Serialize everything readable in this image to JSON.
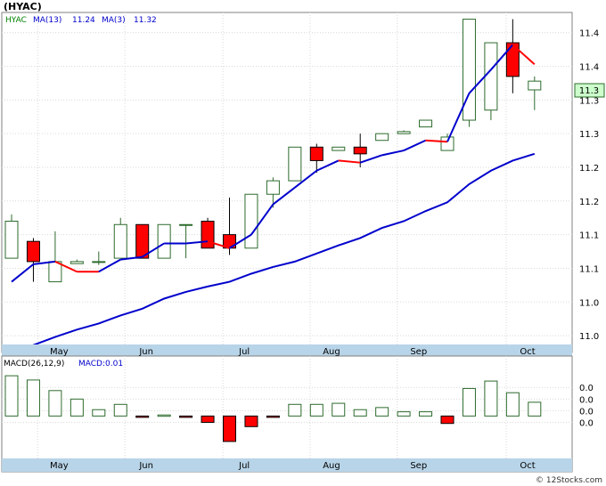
{
  "chart_data": {
    "type": "candlestick",
    "title": "(HYAC)",
    "credit": "© 12Stocks.com",
    "colors": {
      "up": "#2d6b2d",
      "down_fill": "#ff0000",
      "ma13": "#0000cc",
      "ma3_up": "#0000cc",
      "ma3_down": "#ff0000",
      "last_badge": "#ccffcc",
      "axis_band": "#b8d4e8"
    },
    "legend": {
      "symbol": "HYAC",
      "ma13_label": "MA(13)",
      "ma13_value": "11.24",
      "ma3_label": "MA(3)",
      "ma3_value": "11.32"
    },
    "last_price_label": "11.3",
    "price_ylim": [
      10.955,
      11.46
    ],
    "price_ticks": [
      {
        "value": 10.98,
        "label": "11.0"
      },
      {
        "value": 11.03,
        "label": "11.0"
      },
      {
        "value": 11.08,
        "label": "11.1"
      },
      {
        "value": 11.13,
        "label": "11.1"
      },
      {
        "value": 11.18,
        "label": "11.2"
      },
      {
        "value": 11.23,
        "label": "11.2"
      },
      {
        "value": 11.28,
        "label": "11.3"
      },
      {
        "value": 11.33,
        "label": "11.3"
      },
      {
        "value": 11.38,
        "label": "11.4"
      },
      {
        "value": 11.43,
        "label": "11.4"
      }
    ],
    "x_labels": [
      "May",
      "Jun",
      "Jul",
      "Aug",
      "Sep",
      "Oct"
    ],
    "month_starts": [
      1.2,
      5.2,
      9.7,
      13.7,
      17.7,
      22.7
    ],
    "candles": [
      {
        "o": 11.095,
        "h": 11.16,
        "l": 11.095,
        "c": 11.15
      },
      {
        "o": 11.12,
        "h": 11.125,
        "l": 11.06,
        "c": 11.09
      },
      {
        "o": 11.06,
        "h": 11.135,
        "l": 11.06,
        "c": 11.09
      },
      {
        "o": 11.087,
        "h": 11.093,
        "l": 11.087,
        "c": 11.09
      },
      {
        "o": 11.09,
        "h": 11.105,
        "l": 11.085,
        "c": 11.09
      },
      {
        "o": 11.095,
        "h": 11.155,
        "l": 11.095,
        "c": 11.145
      },
      {
        "o": 11.145,
        "h": 11.145,
        "l": 11.095,
        "c": 11.095
      },
      {
        "o": 11.095,
        "h": 11.145,
        "l": 11.095,
        "c": 11.145
      },
      {
        "o": 11.145,
        "h": 11.145,
        "l": 11.095,
        "c": 11.145
      },
      {
        "o": 11.15,
        "h": 11.155,
        "l": 11.11,
        "c": 11.11
      },
      {
        "o": 11.13,
        "h": 11.185,
        "l": 11.1,
        "c": 11.11
      },
      {
        "o": 11.11,
        "h": 11.19,
        "l": 11.11,
        "c": 11.19
      },
      {
        "o": 11.19,
        "h": 11.215,
        "l": 11.17,
        "c": 11.21
      },
      {
        "o": 11.21,
        "h": 11.26,
        "l": 11.21,
        "c": 11.26
      },
      {
        "o": 11.26,
        "h": 11.265,
        "l": 11.222,
        "c": 11.24
      },
      {
        "o": 11.255,
        "h": 11.26,
        "l": 11.255,
        "c": 11.26
      },
      {
        "o": 11.26,
        "h": 11.28,
        "l": 11.23,
        "c": 11.25
      },
      {
        "o": 11.27,
        "h": 11.28,
        "l": 11.27,
        "c": 11.28
      },
      {
        "o": 11.28,
        "h": 11.285,
        "l": 11.28,
        "c": 11.283
      },
      {
        "o": 11.29,
        "h": 11.3,
        "l": 11.29,
        "c": 11.3
      },
      {
        "o": 11.255,
        "h": 11.28,
        "l": 11.255,
        "c": 11.275
      },
      {
        "o": 11.3,
        "h": 11.45,
        "l": 11.29,
        "c": 11.45
      },
      {
        "o": 11.315,
        "h": 11.415,
        "l": 11.3,
        "c": 11.415
      },
      {
        "o": 11.415,
        "h": 11.45,
        "l": 11.34,
        "c": 11.365
      },
      {
        "o": 11.345,
        "h": 11.365,
        "l": 11.315,
        "c": 11.358
      }
    ],
    "ma13": [
      10.955,
      10.966,
      10.978,
      10.989,
      10.998,
      11.01,
      11.02,
      11.035,
      11.045,
      11.053,
      11.06,
      11.072,
      11.082,
      11.09,
      11.102,
      11.114,
      11.125,
      11.14,
      11.15,
      11.165,
      11.178,
      11.205,
      11.225,
      11.24,
      11.25
    ],
    "ma13_start_index": 0,
    "ma3": [
      11.06,
      11.086,
      11.09,
      11.075,
      11.075,
      11.093,
      11.097,
      11.117,
      11.117,
      11.12,
      11.11,
      11.13,
      11.175,
      11.2,
      11.225,
      11.24,
      11.237,
      11.248,
      11.255,
      11.27,
      11.268,
      11.34,
      11.375,
      11.412,
      11.383
    ],
    "ma3_trend": [
      "up",
      "up",
      "up",
      "down",
      "down",
      "up",
      "up",
      "up",
      "up",
      "up",
      "down",
      "up",
      "up",
      "up",
      "up",
      "up",
      "down",
      "up",
      "up",
      "up",
      "down",
      "up",
      "up",
      "up",
      "down"
    ],
    "macd_legend": {
      "label": "MACD(26,12,9)",
      "value_label": "MACD:0.01"
    },
    "macd_ylim": [
      -0.02,
      0.022
    ],
    "macd_ticks": [
      {
        "value": 0.0135,
        "label": "0.0"
      },
      {
        "value": 0.008,
        "label": "0.0"
      },
      {
        "value": 0.0025,
        "label": "0.0"
      },
      {
        "value": -0.003,
        "label": "0.0"
      }
    ],
    "macd": [
      0.019,
      0.017,
      0.012,
      0.008,
      0.003,
      0.0055,
      -0.0005,
      0.0005,
      -0.0003,
      -0.003,
      -0.012,
      -0.005,
      -0.0005,
      0.0055,
      0.0055,
      0.006,
      0.003,
      0.004,
      0.002,
      0.002,
      -0.0035,
      0.013,
      0.0165,
      0.011,
      0.0065
    ]
  }
}
